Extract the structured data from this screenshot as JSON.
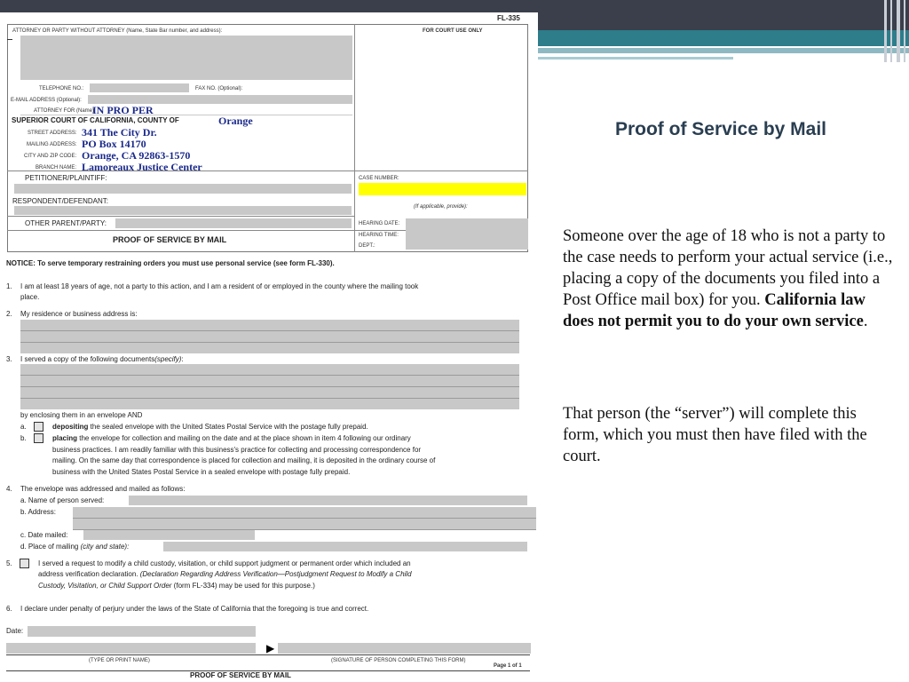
{
  "slide": {
    "title": "Proof of Service by Mail",
    "para1_text": "Someone over the age of 18 who is not a party to the case needs to perform your actual service (i.e., placing a copy of the documents you filed into a Post Office mail box) for you.  ",
    "para1_bold": "California law does not permit you to do your own service",
    "para1_end": ".",
    "para2": "That person (the “server”) will complete this form, which you must then have filed with the court."
  },
  "form": {
    "form_id": "FL-335",
    "attorney_label": "ATTORNEY OR PARTY WITHOUT ATTORNEY (Name, State Bar number, and address):",
    "court_use_label": "FOR COURT USE ONLY",
    "telephone_label": "TELEPHONE NO.:",
    "fax_label": "FAX NO. (Optional):",
    "email_label": "E-MAIL ADDRESS (Optional):",
    "attorney_for_label": "ATTORNEY FOR (Name):",
    "attorney_for_value": "IN PRO PER",
    "court_label": "SUPERIOR COURT OF CALIFORNIA, COUNTY OF",
    "county_value": "Orange",
    "street_label": "STREET ADDRESS:",
    "street_value": "341 The City Dr.",
    "mailing_label": "MAILING ADDRESS:",
    "mailing_value": "PO Box 14170",
    "city_label": "CITY AND ZIP CODE:",
    "city_value": "Orange, CA  92863-1570",
    "branch_label": "BRANCH NAME:",
    "branch_value": "Lamoreaux Justice Center",
    "petitioner_label": "PETITIONER/PLAINTIFF:",
    "respondent_label": "RESPONDENT/DEFENDANT:",
    "other_party_label": "OTHER PARENT/PARTY:",
    "case_number_label": "CASE NUMBER:",
    "if_applicable": "(If applicable, provide):",
    "hearing_date_label": "HEARING DATE:",
    "hearing_time_label": "HEARING TIME:",
    "dept_label": "DEPT.:",
    "form_title": "PROOF OF SERVICE BY MAIL",
    "notice": "NOTICE: To serve temporary restraining orders you must use personal service (see form FL-330).",
    "item1_num": "1.",
    "item1_l1": "I am at least 18 years of age, not a party to this action, and I am a resident of or employed in the county where the mailing took",
    "item1_l2": "place.",
    "item2_num": "2.",
    "item2": "My residence or business address is:",
    "item3_num": "3.",
    "item3": "I served a copy of the following documents",
    "item3_specify": "(specify)",
    "item3_colon": ":",
    "enclosing": "by enclosing them in an envelope AND",
    "a_letter": "a.",
    "a_bold": "depositing",
    "a_rest": " the sealed envelope with the United States Postal Service with the postage fully prepaid.",
    "b_letter": "b.",
    "b_bold": "placing",
    "b_rest1": " the envelope for collection and mailing on the date and at the place shown in item 4 following our ordinary",
    "b_rest2": "business practices. I am readily familiar with this business's practice for collecting and processing correspondence for",
    "b_rest3": "mailing. On the same day that correspondence is placed for collection and mailing, it is deposited in the ordinary course of",
    "b_rest4": "business with the United States Postal Service in a sealed envelope with postage fully prepaid.",
    "item4_num": "4.",
    "item4": "The envelope was addressed and mailed as follows:",
    "item4a": "a.   Name of person served:",
    "item4b": "b.   Address:",
    "item4c": "c.   Date mailed:",
    "item4d": "d.   Place of mailing",
    "item4d_it": "(city and state):",
    "item5_num": "5.",
    "item5_l1": "I served a request to modify a child custody, visitation, or child support judgment or permanent order which included an",
    "item5_l2a": "address verification declaration. ",
    "item5_l2b": "(Declaration Regarding Address Verification—Postjudgment Request to Modify a Child",
    "item5_l3a": "Custody, Visitation, or Child Support Order",
    "item5_l3b": " (form FL-334) may be used for this purpose.)",
    "item6_num": "6.",
    "item6": "I declare under penalty of perjury under the laws of the State of California that the foregoing is true and correct.",
    "date_label": "Date:",
    "type_name": "(TYPE OR PRINT NAME)",
    "signature": "(SIGNATURE OF PERSON COMPLETING THIS FORM)",
    "page_of": "Page 1 of 1",
    "footer_title": "PROOF OF SERVICE BY MAIL"
  },
  "colors": {
    "topbar": "#3b3f4c",
    "teal_band": "#2d7d8b",
    "title_color": "#2a3e51",
    "highlight": "#ffff00",
    "handwriting": "#1b2a8c"
  }
}
